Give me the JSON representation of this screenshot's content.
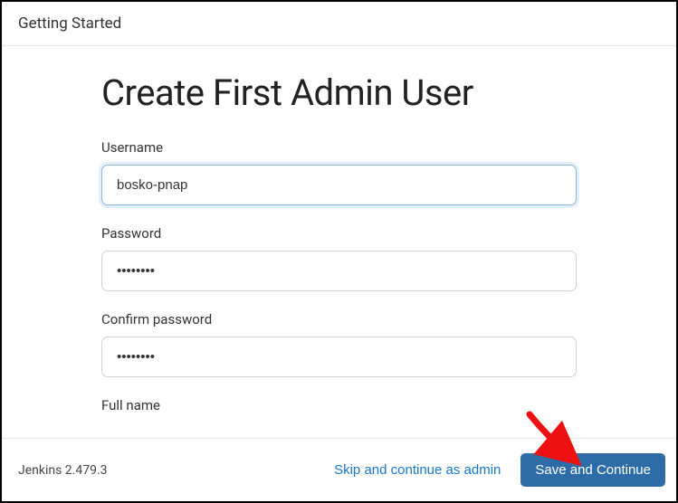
{
  "header": {
    "title": "Getting Started"
  },
  "form": {
    "heading": "Create First Admin User",
    "username": {
      "label": "Username",
      "value": "bosko-pnap"
    },
    "password": {
      "label": "Password",
      "value": "••••••••"
    },
    "confirm": {
      "label": "Confirm password",
      "value": "••••••••"
    },
    "fullname": {
      "label": "Full name"
    }
  },
  "footer": {
    "version": "Jenkins 2.479.3",
    "skip_label": "Skip and continue as admin",
    "save_label": "Save and Continue"
  }
}
